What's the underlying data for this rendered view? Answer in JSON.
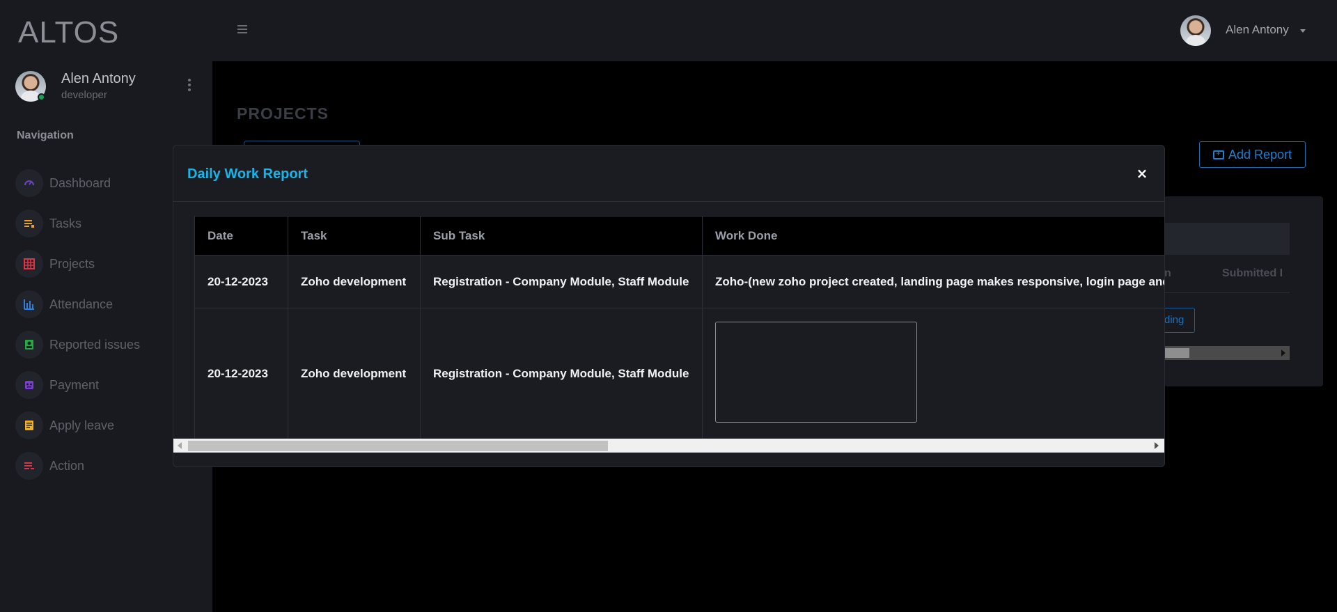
{
  "brand": "ALTOS",
  "user": {
    "name": "Alen Antony",
    "role": "developer"
  },
  "navigation": {
    "title": "Navigation",
    "items": [
      {
        "label": "Dashboard",
        "icon": "gauge-icon",
        "color": "#6f42c1"
      },
      {
        "label": "Tasks",
        "icon": "list-icon",
        "color": "#f0a020"
      },
      {
        "label": "Projects",
        "icon": "grid-icon",
        "color": "#dc3545"
      },
      {
        "label": "Attendance",
        "icon": "bar-chart-icon",
        "color": "#2f7de1"
      },
      {
        "label": "Reported issues",
        "icon": "contact-card-icon",
        "color": "#28a745"
      },
      {
        "label": "Payment",
        "icon": "robot-icon",
        "color": "#7b3fd0"
      },
      {
        "label": "Apply leave",
        "icon": "document-icon",
        "color": "#f0b020"
      },
      {
        "label": "Action",
        "icon": "list-remove-icon",
        "color": "#dc3545"
      }
    ]
  },
  "topbar": {
    "username": "Alen Antony"
  },
  "page": {
    "title": "PROJECTS",
    "add_report_label": "Add Report",
    "bg_table": {
      "col1": "n",
      "col2": "Submitted I",
      "pending": "ding"
    }
  },
  "modal": {
    "title": "Daily Work Report",
    "close": "×",
    "columns": [
      "Date",
      "Task",
      "Sub Task",
      "Work Done"
    ],
    "rows": [
      {
        "date": "20-12-2023",
        "task": "Zoho development",
        "subtask": "Registration - Company Module, Staff Module",
        "work_done": "Zoho-(new zoho project created, landing page makes responsive, login page and"
      },
      {
        "date": "20-12-2023",
        "task": "Zoho development",
        "subtask": "Registration - Company Module, Staff Module",
        "work_done": ""
      }
    ]
  },
  "colors": {
    "accent": "#1ab3e6",
    "primary": "#1f7fd0",
    "background": "#000000",
    "sidebar": "#181a20"
  }
}
